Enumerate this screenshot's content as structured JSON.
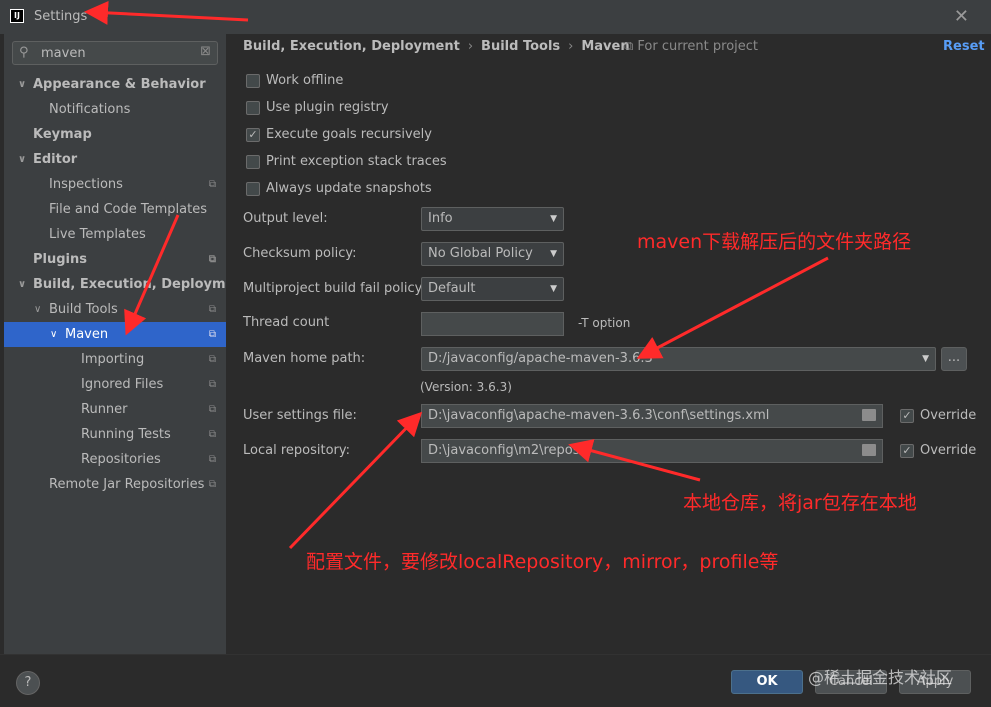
{
  "window": {
    "title": "Settings",
    "logo_text": "IJ",
    "close_glyph": "✕"
  },
  "search": {
    "value": "maven",
    "placeholder": ""
  },
  "tree": [
    {
      "label": "Appearance & Behavior",
      "expanded": true
    },
    {
      "label": "Notifications"
    },
    {
      "label": "Keymap"
    },
    {
      "label": "Editor",
      "expanded": true
    },
    {
      "label": "Inspections",
      "project_icon": "project-scope-icon"
    },
    {
      "label": "File and Code Templates"
    },
    {
      "label": "Live Templates"
    },
    {
      "label": "Plugins",
      "project_icon": "project-scope-icon"
    },
    {
      "label": "Build, Execution, Deployment",
      "expanded": true
    },
    {
      "label": "Build Tools",
      "expanded": true
    },
    {
      "label": "Maven",
      "expanded": true,
      "selected": true
    },
    {
      "label": "Importing"
    },
    {
      "label": "Ignored Files"
    },
    {
      "label": "Runner"
    },
    {
      "label": "Running Tests"
    },
    {
      "label": "Repositories"
    },
    {
      "label": "Remote Jar Repositories"
    }
  ],
  "breadcrumb": {
    "part1": "Build, Execution, Deployment",
    "part2": "Build Tools",
    "part3": "Maven",
    "separator": "›"
  },
  "for_project": "⧉ For current project",
  "reset_label": "Reset",
  "options": [
    {
      "label": "Work offline",
      "checked": false
    },
    {
      "label": "Use plugin registry",
      "checked": false
    },
    {
      "label": "Execute goals recursively",
      "checked": true
    },
    {
      "label": "Print exception stack traces",
      "checked": false
    },
    {
      "label": "Always update snapshots",
      "checked": false
    }
  ],
  "fields": {
    "output_level": {
      "label": "Output level:",
      "value": "Info"
    },
    "checksum_policy": {
      "label": "Checksum policy:",
      "value": "No Global Policy"
    },
    "fail_policy": {
      "label": "Multiproject build fail policy:",
      "value": "Default"
    },
    "thread_count": {
      "label": "Thread count",
      "value": "",
      "hint": "-T option"
    },
    "maven_home": {
      "label": "Maven home path:",
      "value": "D:/javaconfig/apache-maven-3.6.3",
      "version": "(Version: 3.6.3)",
      "browse": "..."
    },
    "user_settings": {
      "label": "User settings file:",
      "value": "D:\\javaconfig\\apache-maven-3.6.3\\conf\\settings.xml",
      "override_label": "Override",
      "override_checked": true
    },
    "local_repo": {
      "label": "Local repository:",
      "value": "D:\\javaconfig\\m2\\repos",
      "override_label": "Override",
      "override_checked": true
    }
  },
  "footer": {
    "help": "?",
    "ok": "OK",
    "cancel": "Cancel",
    "apply": "Apply"
  },
  "annotations": {
    "maven_path": "maven下载解压后的文件夹路径",
    "local_repo": "本地仓库，将jar包存在本地",
    "settings_file": "配置文件，要修改localRepository，mirror，profile等"
  },
  "watermark": "@稀土掘金技术社区",
  "colors": {
    "accent": "#2f65ca",
    "annotation": "#ff2a2a",
    "link": "#589df6",
    "ok_button": "#365880"
  }
}
